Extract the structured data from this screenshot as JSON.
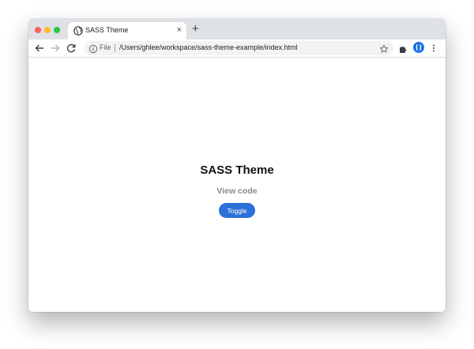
{
  "browser": {
    "tab": {
      "title": "SASS Theme",
      "close_glyph": "×",
      "icon": "globe-icon"
    },
    "new_tab_glyph": "+",
    "address": {
      "scheme_label": "File",
      "url": "/Users/ghlee/workspace/sass-theme-example/index.html"
    },
    "icons": [
      "back-arrow-icon",
      "forward-arrow-icon",
      "reload-icon",
      "info-icon",
      "star-icon",
      "extensions-puzzle-icon",
      "profile-avatar-icon",
      "more-vert-icon"
    ],
    "colors": {
      "tabstrip": "#dee1e6",
      "profile": "#1a73e8"
    }
  },
  "page": {
    "title": "SASS Theme",
    "view_code_label": "View code",
    "toggle_label": "Toggle",
    "colors": {
      "toggle_bg": "#2c6fd8",
      "link": "#8a8a8a"
    }
  }
}
